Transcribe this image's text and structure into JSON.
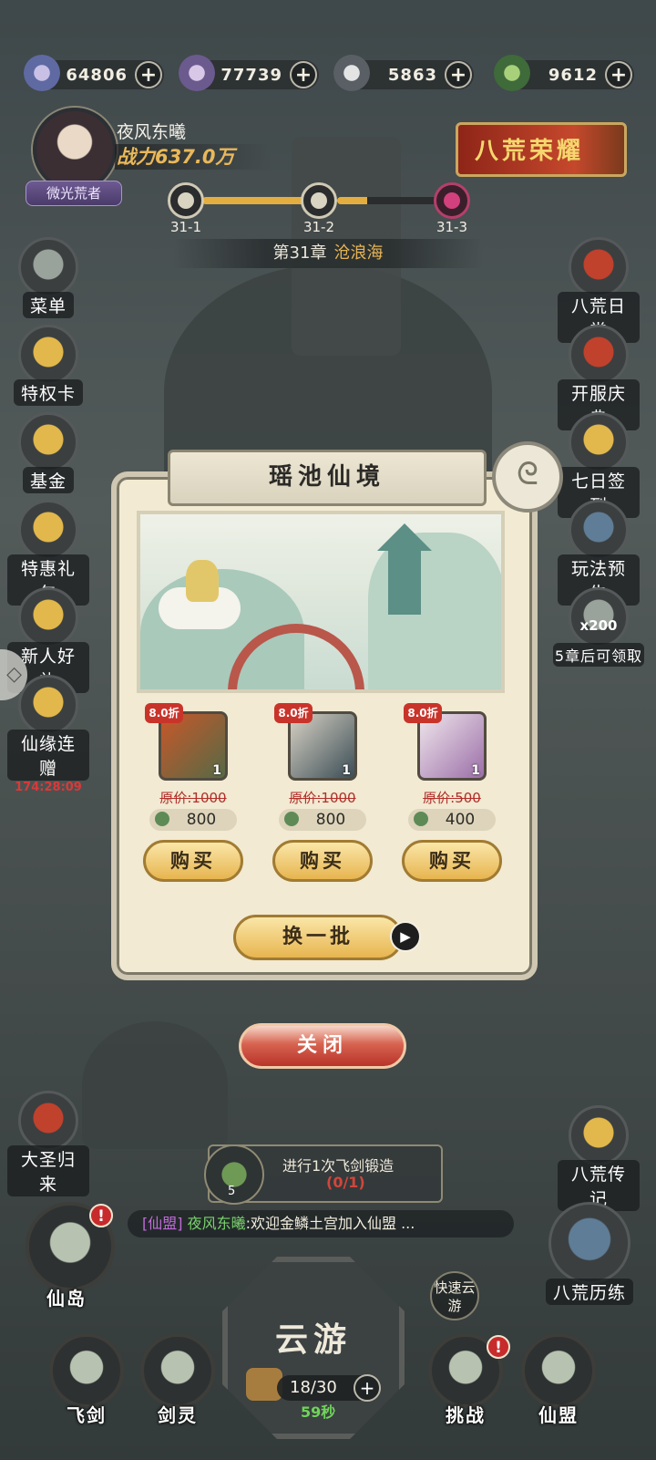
{
  "resources": [
    {
      "icon": "spirit-orb-icon",
      "value": "64806"
    },
    {
      "icon": "crystal-icon",
      "value": "77739"
    },
    {
      "icon": "ore-icon",
      "value": "5863"
    },
    {
      "icon": "jade-dragon-icon",
      "value": "9612"
    }
  ],
  "player": {
    "name": "夜风东曦",
    "power": "战力637.0万",
    "rank": "微光荒者"
  },
  "glory_banner": "八荒荣耀",
  "stage_progress": [
    {
      "label": "31-1"
    },
    {
      "label": "31-2"
    },
    {
      "label": "31-3"
    }
  ],
  "chapter": {
    "prefix": "第31章",
    "name": "沧浪海"
  },
  "left_menu": [
    {
      "label": "菜单"
    },
    {
      "label": "特权卡"
    },
    {
      "label": "基金"
    },
    {
      "label": "特惠礼包"
    },
    {
      "label": "新人好礼"
    },
    {
      "label": "仙缘连赠",
      "timer": "174:28:09"
    },
    {
      "label": "大圣归来"
    }
  ],
  "right_menu": [
    {
      "label": "八荒日常"
    },
    {
      "label": "开服庆典"
    },
    {
      "label": "七日签到"
    },
    {
      "label": "玩法预告"
    },
    {
      "label": "5章后可领取",
      "badge": "x200"
    },
    {
      "label": "八荒传记"
    },
    {
      "label": "八荒历练"
    }
  ],
  "popup": {
    "title": "瑶池仙境",
    "items": [
      {
        "discount": "8.0折",
        "qty": "1",
        "original": "原价:1000",
        "price": "800",
        "buy": "购买"
      },
      {
        "discount": "8.0折",
        "qty": "1",
        "original": "原价:1000",
        "price": "800",
        "buy": "购买"
      },
      {
        "discount": "8.0折",
        "qty": "1",
        "original": "原价:500",
        "price": "400",
        "buy": "购买"
      }
    ],
    "refresh": "换一批",
    "close": "关闭"
  },
  "quest": {
    "count": "5",
    "text": "进行1次飞剑锻造",
    "progress": "(0/1)"
  },
  "chat": {
    "tag": "[仙盟]",
    "name": "夜风东曦",
    "message": ":欢迎金鳞土宫加入仙盟 ..."
  },
  "bottom": {
    "island": "仙岛",
    "flying_sword": "飞剑",
    "sword_spirit": "剑灵",
    "cloud_travel": "云游",
    "stamina": "18/30",
    "countdown": "59秒",
    "quick_travel": "快速云游",
    "challenge": "挑战",
    "alliance": "仙盟"
  },
  "colors": {
    "accent_gold": "#e7b54f",
    "discount_red": "#c9342a",
    "alert_red": "#c72b2b",
    "chat_name": "#79d26c",
    "chat_tag": "#c06ad9"
  }
}
